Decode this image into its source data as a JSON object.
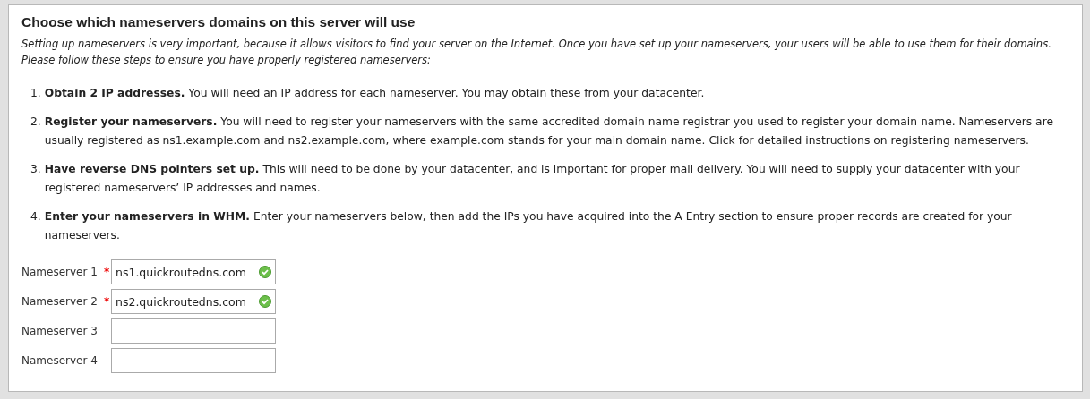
{
  "panel": {
    "title": "Choose which nameservers domains on this server will use",
    "intro": "Setting up nameservers is very important, because it allows visitors to find your server on the Internet. Once you have set up your nameservers, your users will be able to use them for their domains. Please follow these steps to ensure you have properly registered nameservers:",
    "steps": [
      {
        "number": "1.",
        "text": "**Obtain 2 IP addresses.** You will need an IP address for each nameserver. You may obtain these from your datacenter."
      },
      {
        "number": "2.",
        "text": "**Register your nameservers.** You will need to register your nameservers with the same accredited domain name registrar you used to register your domain name. Nameservers are usually registered as ns1.example.com and ns2.example.com, where example.com stands for your main domain name. Click for detailed instructions on registering nameservers."
      },
      {
        "number": "3.",
        "text": "**Have reverse DNS pointers set up.** This will need to be done by your datacenter, and is important for proper mail delivery. You will need to supply your datacenter with your registered nameservers’ IP addresses and names."
      },
      {
        "number": "4.",
        "text": "**Enter your nameservers in WHM.** Enter your nameservers below, then add the IPs you have acquired into the A Entry section to ensure proper records are created for your nameservers."
      }
    ],
    "nameservers": [
      {
        "label": "Nameserver 1",
        "marker": "*",
        "value": "ns1.quickroutedns.com",
        "valid": true
      },
      {
        "label": "Nameserver 2",
        "marker": "*",
        "value": "ns2.quickroutedns.com",
        "valid": true
      },
      {
        "label": "Nameserver 3",
        "valid": false
      },
      {
        "label": "Nameserver 4",
        "valid": false
      }
    ]
  }
}
